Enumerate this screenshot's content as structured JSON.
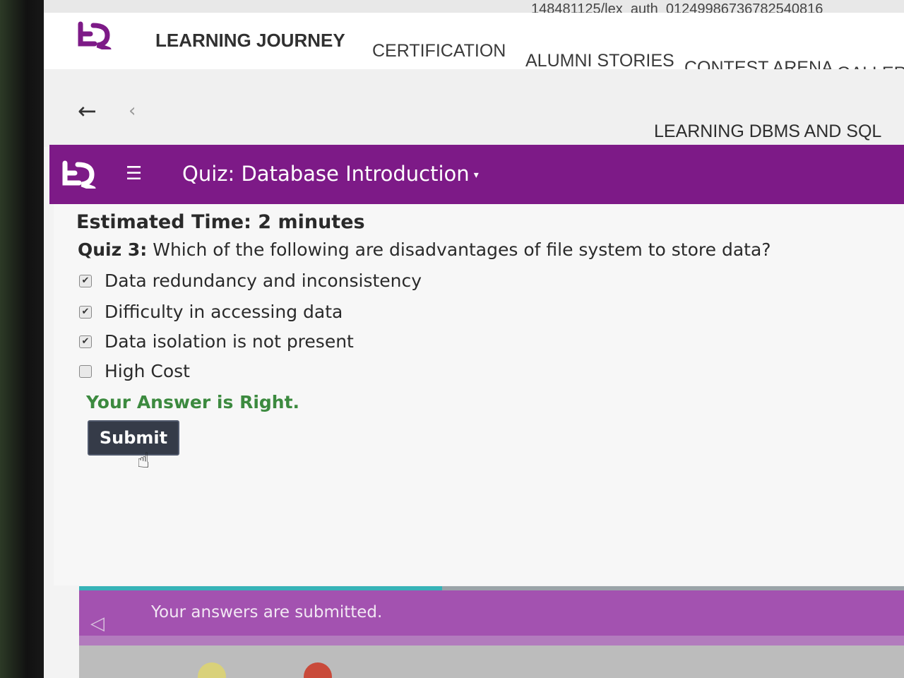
{
  "url": {
    "visible_text": "148481125/lex_auth_01249986736782540816"
  },
  "topnav": {
    "brand": "LEARNING JOURNEY",
    "items": [
      {
        "label": "CERTIFICATION"
      },
      {
        "label": "ALUMNI STORIES"
      },
      {
        "label": "CONTEST ARENA"
      },
      {
        "label": "GALLERY"
      }
    ]
  },
  "breadcrumb": {
    "back_icon": "arrow-left-icon",
    "prev_icon": "chevron-left-icon",
    "course_title": "LEARNING DBMS AND SQL"
  },
  "quiz_bar": {
    "title": "Quiz: Database Introduction",
    "caret": "▾",
    "menu_icon": "hamburger-menu-icon",
    "accent_color": "#7d1a87"
  },
  "quiz": {
    "estimated_time": "Estimated Time: 2 minutes",
    "question_number": "Quiz 3:",
    "question_text": "Which of the following are disadvantages of file system to store data?",
    "options": [
      {
        "label": "Data redundancy and inconsistency",
        "checked": true
      },
      {
        "label": "Difficulty in accessing data",
        "checked": true
      },
      {
        "label": "Data isolation is not present",
        "checked": true
      },
      {
        "label": "High Cost",
        "checked": false
      }
    ],
    "result": "Your Answer is Right.",
    "result_color": "#3c8a3f",
    "submit_label": "Submit"
  },
  "footer": {
    "progress": 0.44,
    "status_text": "Your answers are submitted.",
    "prev_icon": "triangle-left-icon",
    "status_color": "#a352b0"
  }
}
